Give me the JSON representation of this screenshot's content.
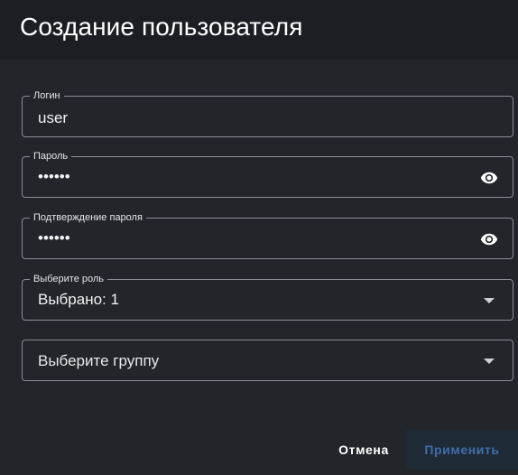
{
  "dialog": {
    "title": "Создание пользователя"
  },
  "form": {
    "login": {
      "label": "Логин",
      "value": "user"
    },
    "password": {
      "label": "Пароль",
      "value": "••••••"
    },
    "confirm": {
      "label": "Подтверждение пароля",
      "value": "••••••"
    },
    "role": {
      "label": "Выберите роль",
      "value": "Выбрано: 1"
    },
    "group": {
      "placeholder": "Выберите группу"
    }
  },
  "actions": {
    "cancel_label": "Отмена",
    "apply_label": "Применить"
  },
  "icons": {
    "password_toggle": "eye-icon",
    "dropdown": "chevron-down-icon"
  },
  "colors": {
    "background": "#22262b",
    "title_bar": "#1b1f24",
    "border": "#8a8e94",
    "apply_text_disabled": "#3f6ea8"
  }
}
